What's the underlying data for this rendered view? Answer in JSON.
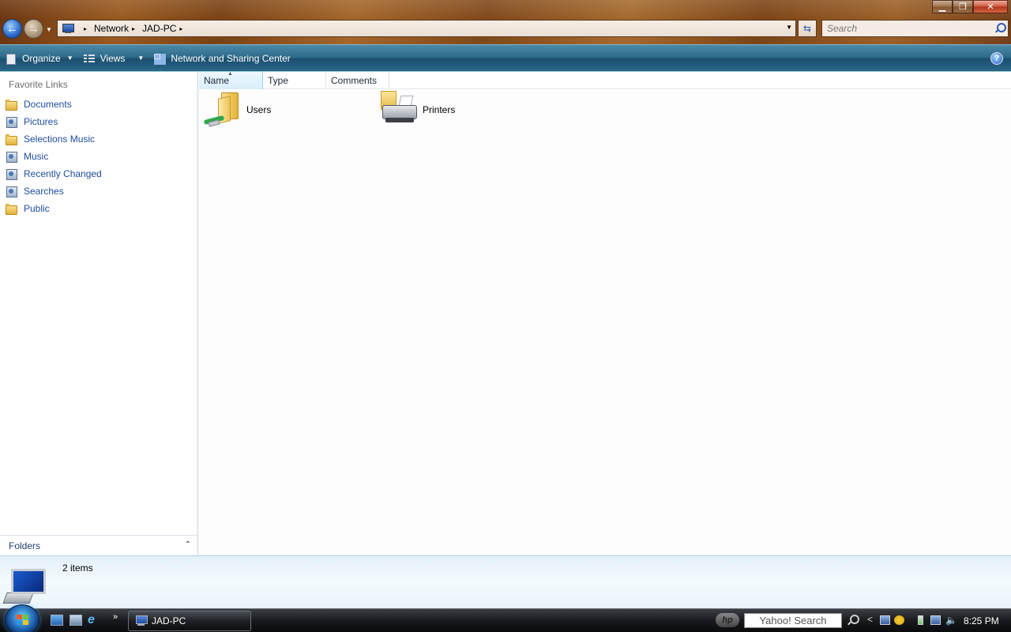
{
  "window": {
    "min_glyph": "▁",
    "max_glyph": "❐",
    "close_glyph": "✕"
  },
  "address_bar": {
    "breadcrumbs": [
      "Network",
      "JAD-PC"
    ],
    "separator": "▸"
  },
  "search": {
    "placeholder": "Search"
  },
  "command_bar": {
    "organize": "Organize",
    "views": "Views",
    "network_center": "Network and Sharing Center",
    "help_glyph": "?"
  },
  "nav_pane": {
    "title": "Favorite Links",
    "items": [
      {
        "label": "Documents",
        "icon": "folder-icon"
      },
      {
        "label": "Pictures",
        "icon": "pictures-library-icon"
      },
      {
        "label": "Selections Music",
        "icon": "folder-icon"
      },
      {
        "label": "Music",
        "icon": "music-library-icon"
      },
      {
        "label": "Recently Changed",
        "icon": "recently-changed-icon"
      },
      {
        "label": "Searches",
        "icon": "searches-icon"
      },
      {
        "label": "Public",
        "icon": "folder-icon"
      }
    ],
    "folders_label": "Folders",
    "folders_chevron": "⌃"
  },
  "columns": {
    "name": "Name",
    "type": "Type",
    "comments": "Comments"
  },
  "items": [
    {
      "label": "Users",
      "icon": "shared-folder-icon"
    },
    {
      "label": "Printers",
      "icon": "printers-icon"
    }
  ],
  "details": {
    "count": "2 items"
  },
  "taskbar": {
    "task_label": "JAD-PC",
    "search_text": "Yahoo! Search",
    "hp_label": "hp",
    "clock": "8:25 PM",
    "more_glyph": "»",
    "tray_chevron": "<"
  }
}
